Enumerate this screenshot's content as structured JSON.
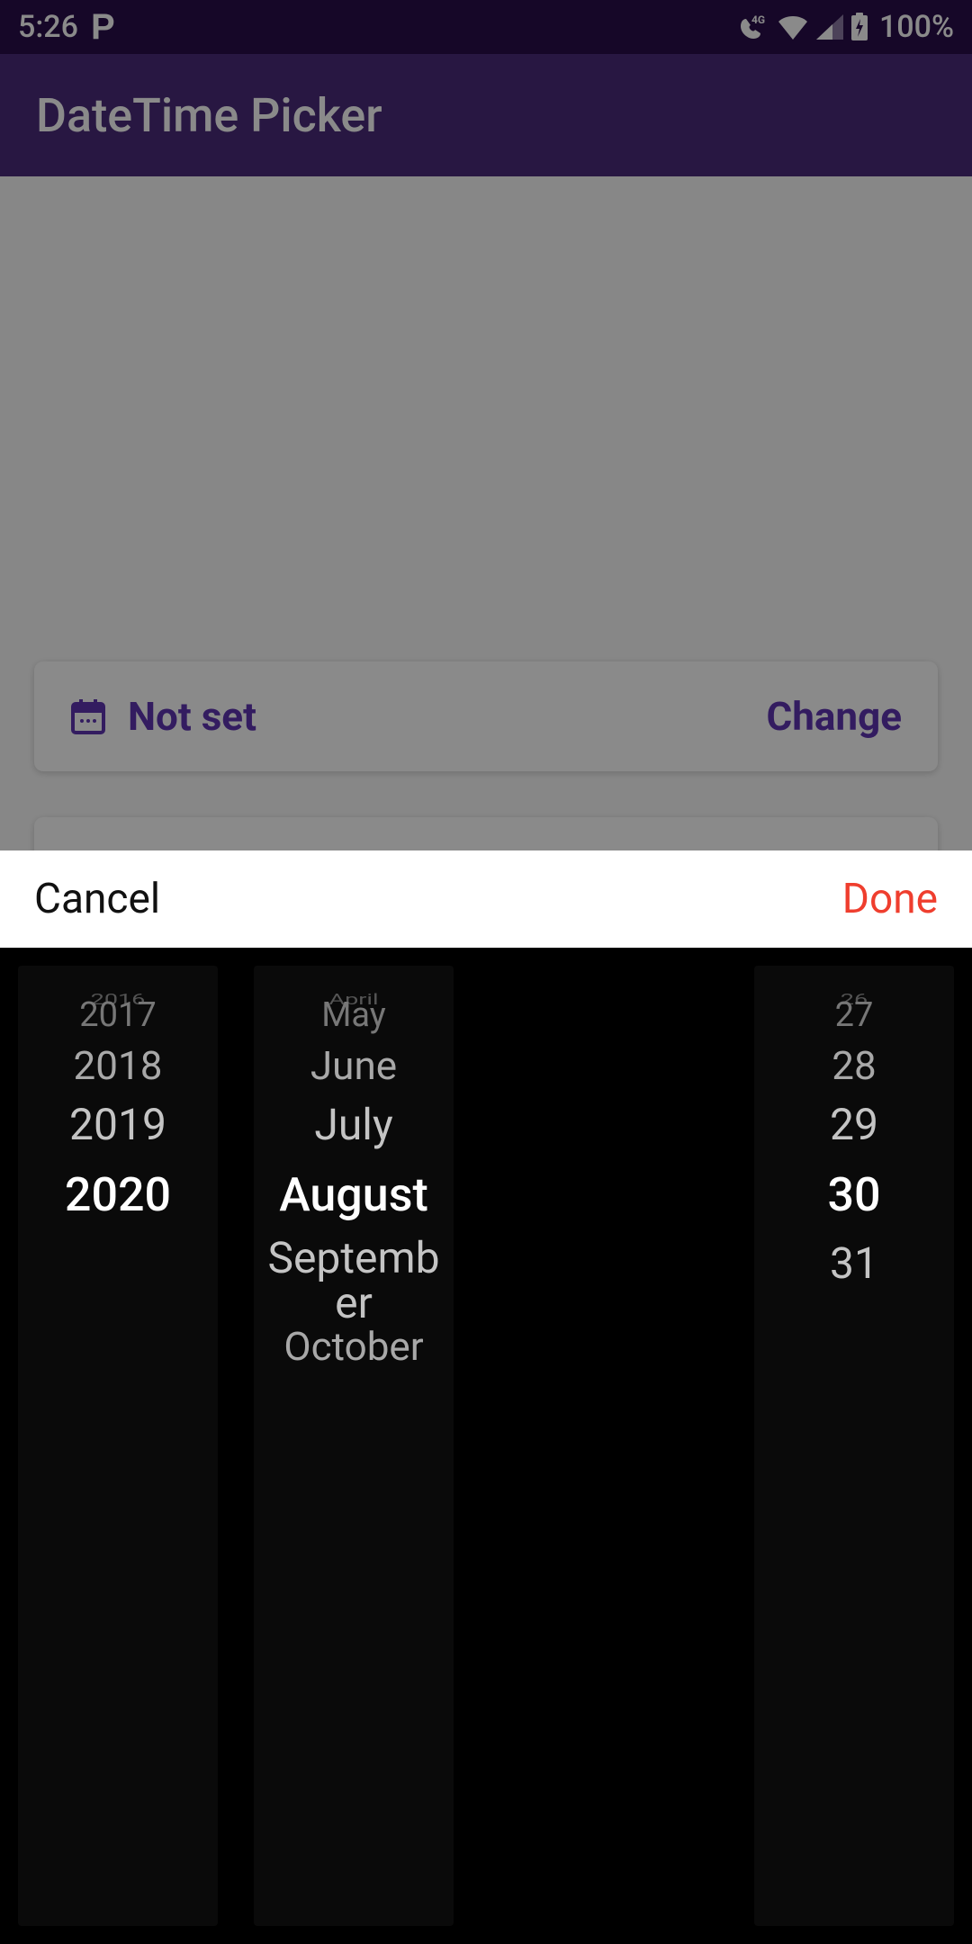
{
  "status": {
    "time": "5:26",
    "battery_pct": "100%",
    "network_label": "4G"
  },
  "appbar": {
    "title": "DateTime Picker"
  },
  "card": {
    "value": "Not set",
    "change_label": "Change"
  },
  "sheet": {
    "cancel": "Cancel",
    "done": "Done"
  },
  "picker": {
    "years": [
      "2016",
      "2017",
      "2018",
      "2019",
      "2020"
    ],
    "months_above": [
      "April",
      "May",
      "June",
      "July"
    ],
    "month_selected": "August",
    "months_below": [
      "September",
      "October"
    ],
    "days": [
      "26",
      "27",
      "28",
      "29",
      "30",
      "31"
    ],
    "selected": {
      "year": "2020",
      "month": "August",
      "day": "30"
    }
  }
}
